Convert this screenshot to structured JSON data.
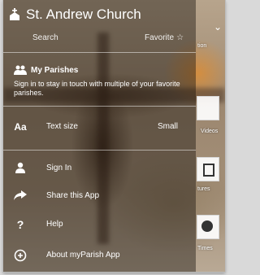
{
  "header": {
    "title": "St. Andrew Church",
    "search": "Search",
    "favorite_label": "Favorite"
  },
  "menu": {
    "my_parishes": {
      "label": "My Parishes",
      "description": "Sign in to stay in touch with multiple of your favorite parishes."
    },
    "text_size": {
      "label": "Text size",
      "value": "Small"
    },
    "sign_in": "Sign In",
    "share": "Share this App",
    "help": "Help",
    "about": "About myParish App"
  },
  "side_panel": {
    "top_text": "tion",
    "labels": [
      "Videos",
      "tures",
      "Times"
    ]
  }
}
